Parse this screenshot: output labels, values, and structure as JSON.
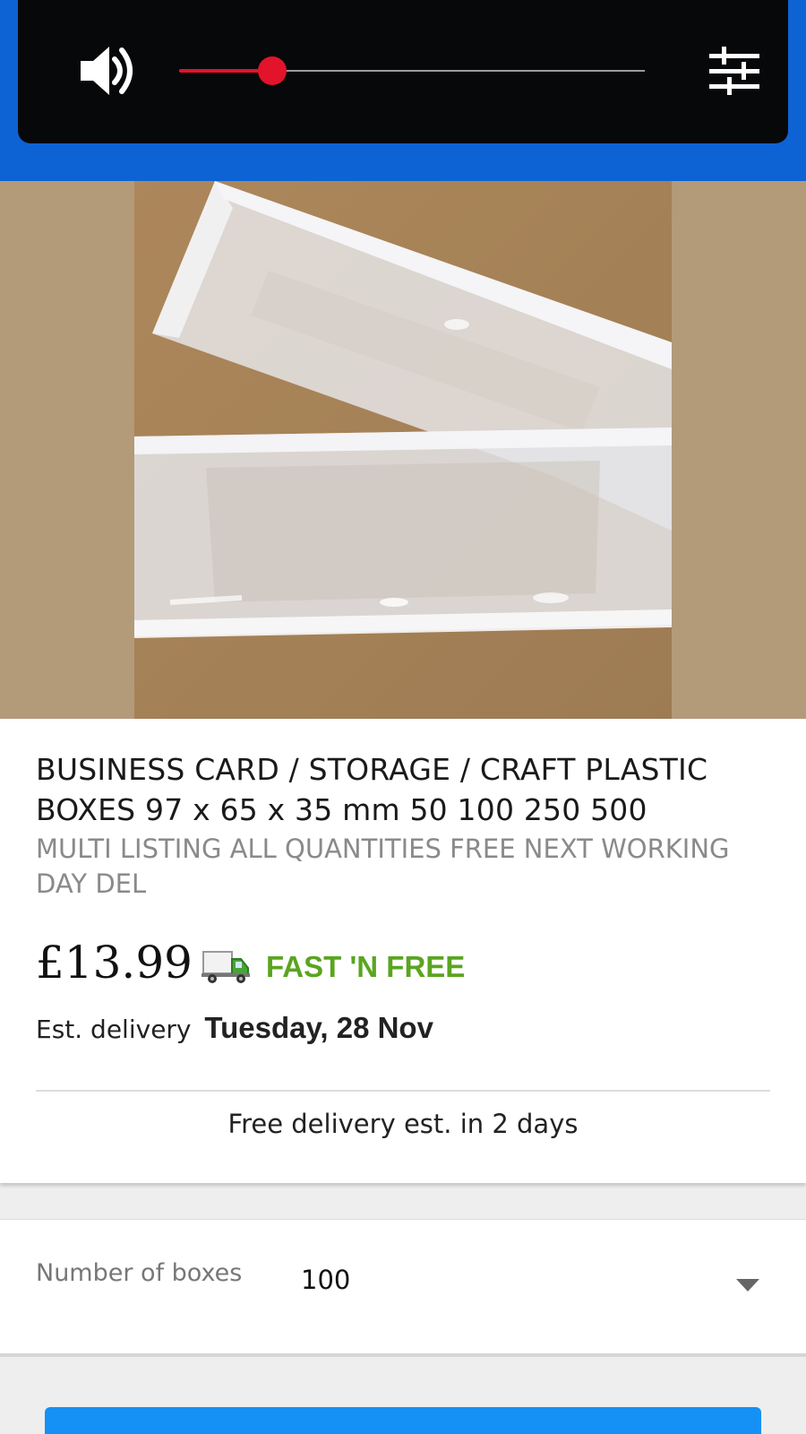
{
  "volume_panel": {
    "volume_level": 0.2,
    "speaker_icon": "speaker-icon",
    "settings_icon": "tune-icon",
    "accent_color": "#e2132b"
  },
  "header": {
    "background_color": "#0e63d4"
  },
  "product": {
    "image_icon": "product-photo",
    "title": "BUSINESS CARD / STORAGE / CRAFT PLASTIC BOXES 97 x 65 x 35 mm 50 100 250 500",
    "subtitle": "MULTI LISTING ALL QUANTITIES FREE NEXT WORKING DAY DEL",
    "price": "£13.99",
    "shipping_icon": "truck-icon",
    "shipping_badge": "FAST 'N FREE",
    "shipping_badge_color": "#5aa520",
    "delivery_label": "Est. delivery",
    "delivery_date": "Tuesday, 28 Nov",
    "free_delivery_note": "Free delivery est. in 2 days"
  },
  "options": {
    "label": "Number of boxes",
    "selected_value": "100",
    "dropdown_icon": "chevron-down-icon"
  },
  "buy_button": {
    "color": "#1590f4"
  }
}
